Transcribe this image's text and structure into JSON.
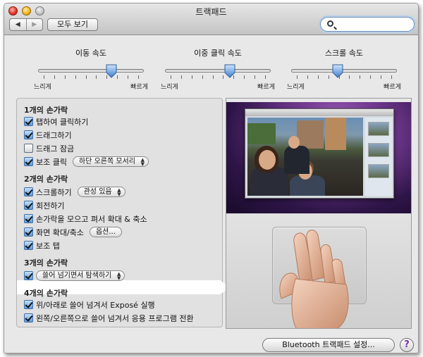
{
  "window": {
    "title": "트랙패드"
  },
  "toolbar": {
    "back_glyph": "◀",
    "forward_glyph": "▶",
    "show_all_label": "모두 보기",
    "search_placeholder": ""
  },
  "sliders": [
    {
      "label": "이동 속도",
      "min_label": "느리게",
      "max_label": "빠르게",
      "value": 0.72
    },
    {
      "label": "이중 클릭 속도",
      "min_label": "느리게",
      "max_label": "빠르게",
      "value": 0.63
    },
    {
      "label": "스크롤 속도",
      "min_label": "느리게",
      "max_label": "빠르게",
      "value": 0.43
    }
  ],
  "gestures": {
    "one_finger": {
      "title": "1개의 손가락",
      "tap_to_click": {
        "label": "탭하여 클릭하기",
        "checked": true
      },
      "dragging": {
        "label": "드래그하기",
        "checked": true
      },
      "drag_lock": {
        "label": "드래그 잠금",
        "checked": false
      },
      "secondary_click": {
        "label": "보조 클릭",
        "checked": true,
        "option": "하단 오른쪽 모서리"
      }
    },
    "two_fingers": {
      "title": "2개의 손가락",
      "scroll": {
        "label": "스크롤하기",
        "checked": true,
        "option": "관성 있음"
      },
      "rotate": {
        "label": "회전하기",
        "checked": true
      },
      "pinch": {
        "label": "손가락을 모으고 펴서 확대 & 축소",
        "checked": true
      },
      "screen_zoom": {
        "label": "화면 확대/축소",
        "checked": true,
        "button": "옵션..."
      },
      "secondary_tap": {
        "label": "보조 탭",
        "checked": true
      }
    },
    "three_fingers": {
      "title": "3개의 손가락",
      "swipe": {
        "checked": true,
        "option": "쓸어 넘기면서 탐색하기"
      }
    },
    "four_fingers": {
      "title": "4개의 손가락",
      "expose": {
        "label": "위/아래로 쓸어 넘겨서 Exposé 실행",
        "checked": true
      },
      "app_switch": {
        "label": "왼쪽/오른쪽으로 쓸어 넘겨서 응용 프로그램 전환",
        "checked": true
      }
    }
  },
  "footer": {
    "bluetooth_button": "Bluetooth 트랙패드 설정...",
    "help_label": "?"
  },
  "colors": {
    "accent": "#5d97d6",
    "help_glyph": "#7b2fa8",
    "desktop": "#7a3d98"
  }
}
